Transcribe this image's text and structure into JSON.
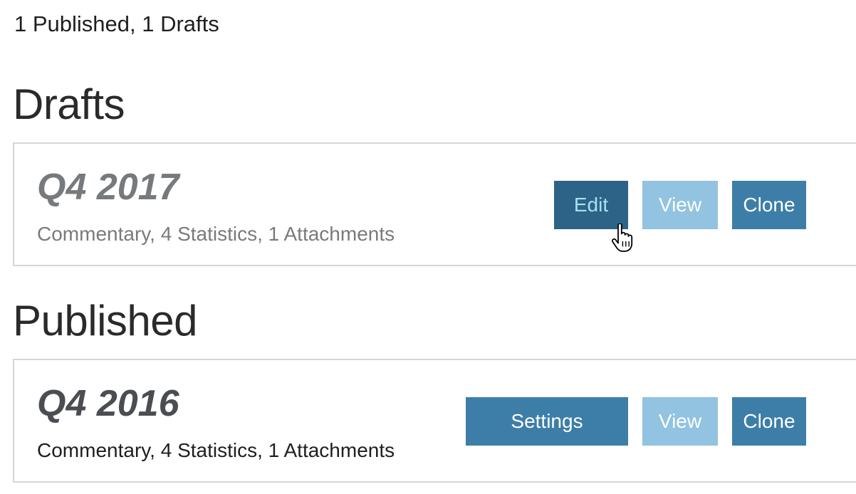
{
  "summary": "1 Published, 1 Drafts",
  "drafts": {
    "heading": "Drafts",
    "items": [
      {
        "title": "Q4 2017",
        "meta": "Commentary, 4 Statistics, 1 Attachments",
        "buttons": {
          "edit": "Edit",
          "view": "View",
          "clone": "Clone"
        }
      }
    ]
  },
  "published": {
    "heading": "Published",
    "items": [
      {
        "title": "Q4 2016",
        "meta": "Commentary, 4 Statistics, 1 Attachments",
        "buttons": {
          "settings": "Settings",
          "view": "View",
          "clone": "Clone"
        }
      }
    ]
  },
  "colors": {
    "primary_button": "#3d7ea8",
    "hovered_button": "#2e6388",
    "light_button": "#92c3e0",
    "card_border": "#d6d6d6"
  },
  "cursor": "hand-pointer-icon"
}
